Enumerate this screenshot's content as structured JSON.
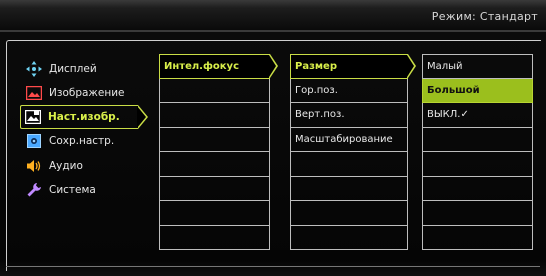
{
  "header": {
    "mode_label": "Режим: Стандарт"
  },
  "menu": {
    "items": [
      {
        "label": "Дисплей",
        "icon": "display-move-icon"
      },
      {
        "label": "Изображение",
        "icon": "picture-icon"
      },
      {
        "label": "Наст.изобр.",
        "icon": "picture-settings-icon",
        "active": true
      },
      {
        "label": "Сохр.настр.",
        "icon": "save-settings-icon"
      },
      {
        "label": "Аудио",
        "icon": "speaker-icon"
      },
      {
        "label": "Система",
        "icon": "wrench-icon"
      }
    ]
  },
  "column1": {
    "items": [
      "Интел.фокус",
      "",
      "",
      "",
      "",
      "",
      "",
      ""
    ]
  },
  "column2": {
    "items": [
      "Размер",
      "Гор.поз.",
      "Верт.поз.",
      "Масштабирование",
      "",
      "",
      "",
      ""
    ]
  },
  "column3": {
    "items": [
      "Малый",
      "Большой",
      "ВЫКЛ.✓",
      "",
      "",
      "",
      "",
      ""
    ]
  },
  "colors": {
    "accent": "#c9dd45",
    "highlight": "#9bbf1d"
  }
}
